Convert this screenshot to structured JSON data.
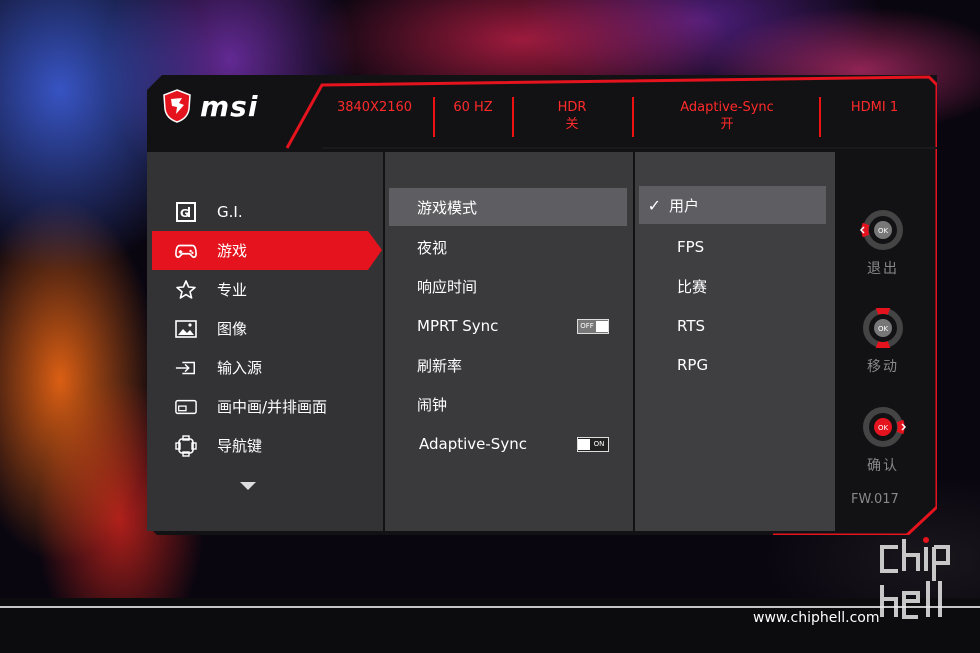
{
  "brand": "msi",
  "status_bar": {
    "resolution": "3840X2160",
    "refresh": "60 HZ",
    "hdr_label": "HDR",
    "hdr_value": "关",
    "adaptive_label": "Adaptive-Sync",
    "adaptive_value": "开",
    "input": "HDMI 1"
  },
  "left_menu": [
    {
      "label": "G.I.",
      "icon": "gi-icon",
      "active": false
    },
    {
      "label": "游戏",
      "icon": "gamepad-icon",
      "active": true
    },
    {
      "label": "专业",
      "icon": "star-icon",
      "active": false
    },
    {
      "label": "图像",
      "icon": "image-icon",
      "active": false
    },
    {
      "label": "输入源",
      "icon": "input-source-icon",
      "active": false
    },
    {
      "label": "画中画/并排画面",
      "icon": "pip-icon",
      "active": false
    },
    {
      "label": "导航键",
      "icon": "navigation-key-icon",
      "active": false
    }
  ],
  "middle_menu": [
    {
      "label": "游戏模式",
      "active": true
    },
    {
      "label": "夜视"
    },
    {
      "label": "响应时间"
    },
    {
      "label": "MPRT Sync",
      "toggle": "OFF"
    },
    {
      "label": "刷新率"
    },
    {
      "label": "闹钟"
    },
    {
      "label": "Adaptive-Sync",
      "toggle": "ON"
    }
  ],
  "right_menu": [
    {
      "label": "用户",
      "checked": true
    },
    {
      "label": "FPS"
    },
    {
      "label": "比赛"
    },
    {
      "label": "RTS"
    },
    {
      "label": "RPG"
    }
  ],
  "nav": {
    "ok": "OK",
    "exit": "退出",
    "move": "移动",
    "confirm": "确认",
    "firmware": "FW.017"
  },
  "watermark": {
    "site": "www.chiphell.com"
  },
  "colors": {
    "accent": "#e4131e",
    "status_text": "#ff2a2a",
    "panel_dark": "#333336",
    "highlight": "#5e5e62"
  }
}
